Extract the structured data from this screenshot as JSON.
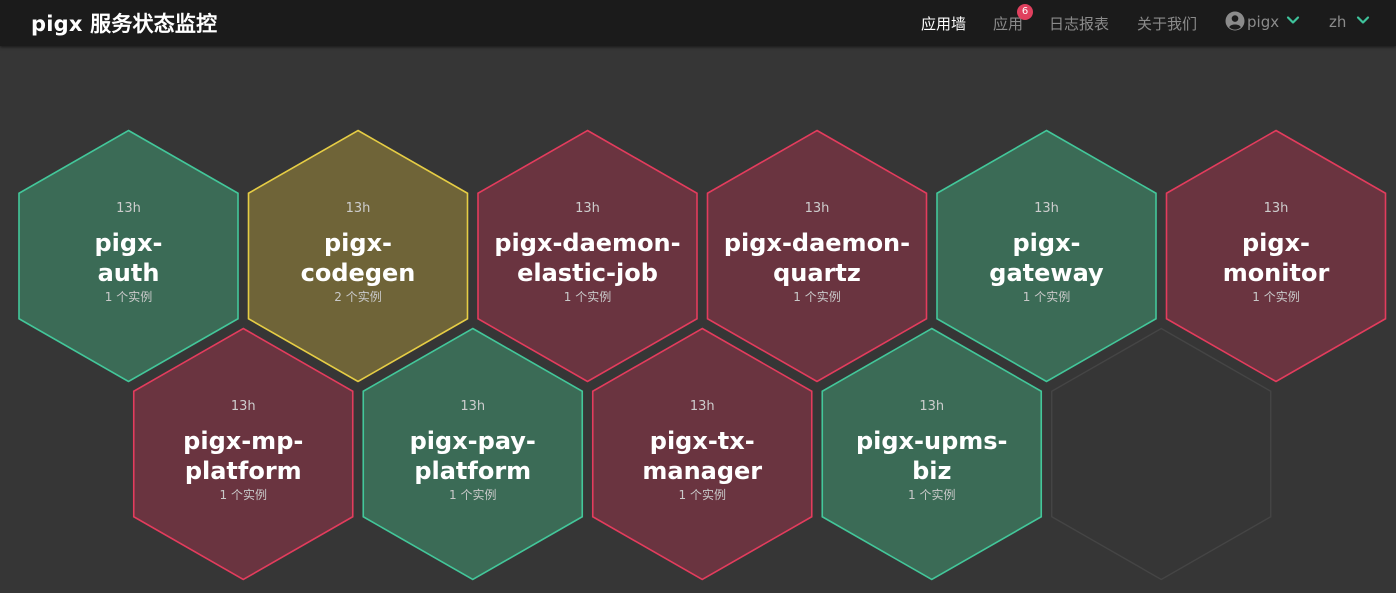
{
  "header": {
    "brand": "pigx 服务状态监控",
    "nav": {
      "wall": "应用墙",
      "apps": "应用",
      "apps_badge": "6",
      "journal": "日志报表",
      "about": "关于我们",
      "user": "pigx",
      "lang": "zh"
    }
  },
  "status_colors": {
    "up": {
      "fill": "#3b6b56",
      "stroke": "#43c79a"
    },
    "down": {
      "fill": "#6a3440",
      "stroke": "#e33c5d"
    },
    "warn": {
      "fill": "#6f6438",
      "stroke": "#e6cd45"
    },
    "empty": {
      "fill": "none",
      "stroke": "#454545"
    }
  },
  "applications": [
    {
      "time": "13h",
      "name_lines": [
        "pigx-",
        "auth"
      ],
      "instances": "1 个实例",
      "status": "up"
    },
    {
      "time": "13h",
      "name_lines": [
        "pigx-",
        "codegen"
      ],
      "instances": "2 个实例",
      "status": "warn"
    },
    {
      "time": "13h",
      "name_lines": [
        "pigx-daemon-",
        "elastic-job"
      ],
      "instances": "1 个实例",
      "status": "down"
    },
    {
      "time": "13h",
      "name_lines": [
        "pigx-daemon-",
        "quartz"
      ],
      "instances": "1 个实例",
      "status": "down"
    },
    {
      "time": "13h",
      "name_lines": [
        "pigx-",
        "gateway"
      ],
      "instances": "1 个实例",
      "status": "up"
    },
    {
      "time": "13h",
      "name_lines": [
        "pigx-",
        "monitor"
      ],
      "instances": "1 个实例",
      "status": "down"
    },
    {
      "time": "13h",
      "name_lines": [
        "pigx-mp-",
        "platform"
      ],
      "instances": "1 个实例",
      "status": "down"
    },
    {
      "time": "13h",
      "name_lines": [
        "pigx-pay-",
        "platform"
      ],
      "instances": "1 个实例",
      "status": "up"
    },
    {
      "time": "13h",
      "name_lines": [
        "pigx-tx-",
        "manager"
      ],
      "instances": "1 个实例",
      "status": "down"
    },
    {
      "time": "13h",
      "name_lines": [
        "pigx-upms-",
        "biz"
      ],
      "instances": "1 个实例",
      "status": "up"
    }
  ]
}
